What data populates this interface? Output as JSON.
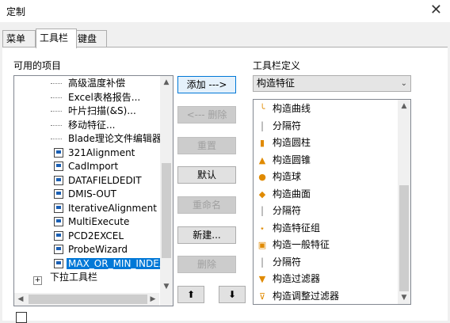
{
  "window": {
    "title": "定制"
  },
  "tabs": [
    {
      "label": "菜单"
    },
    {
      "label": "工具栏"
    },
    {
      "label": "键盘"
    }
  ],
  "left": {
    "label": "可用的项目",
    "items": [
      {
        "text": "高级温度补偿",
        "icon": "dash-line"
      },
      {
        "text": "Excel表格报告...",
        "icon": "dash-line"
      },
      {
        "text": "叶片扫描(&S)...",
        "icon": "dash-line"
      },
      {
        "text": "移动特征...",
        "icon": "dash-line"
      },
      {
        "text": "Blade理论文件编辑器(&",
        "icon": "dash-line"
      },
      {
        "text": "321Alignment",
        "icon": "macro-icon"
      },
      {
        "text": "CadImport",
        "icon": "macro-icon"
      },
      {
        "text": "DATAFIELDEDIT",
        "icon": "macro-icon"
      },
      {
        "text": "DMIS-OUT",
        "icon": "macro-icon"
      },
      {
        "text": "IterativeAlignment",
        "icon": "macro-icon"
      },
      {
        "text": "MultiExecute",
        "icon": "macro-icon"
      },
      {
        "text": "PCD2EXCEL",
        "icon": "macro-icon"
      },
      {
        "text": "ProbeWizard",
        "icon": "macro-icon"
      },
      {
        "text": "MAX_OR_MIN_INDEX",
        "icon": "macro-icon",
        "selected": true
      },
      {
        "text": "下拉工具栏",
        "icon": "expand-icon"
      }
    ]
  },
  "buttons": {
    "add": "添加 --->",
    "remove": "<--- 删除",
    "reset": "重置",
    "default": "默认",
    "rename": "重命名",
    "new": "新建...",
    "delete": "删除",
    "up": "⬆",
    "down": "⬇"
  },
  "right": {
    "label": "工具栏定义",
    "combo_value": "构造特征",
    "items": [
      {
        "text": "构造曲线",
        "icon": "curve-icon"
      },
      {
        "text": "分隔符",
        "icon": "separator-icon"
      },
      {
        "text": "构造圆柱",
        "icon": "cylinder-icon"
      },
      {
        "text": "构造圆锥",
        "icon": "cone-icon"
      },
      {
        "text": "构造球",
        "icon": "sphere-icon"
      },
      {
        "text": "构造曲面",
        "icon": "surface-icon"
      },
      {
        "text": "分隔符",
        "icon": "separator-icon"
      },
      {
        "text": "构造特征组",
        "icon": "feature-set-icon"
      },
      {
        "text": "构造一般特征",
        "icon": "generic-feature-icon"
      },
      {
        "text": "分隔符",
        "icon": "separator-icon"
      },
      {
        "text": "构造过滤器",
        "icon": "filter-icon"
      },
      {
        "text": "构造调整过滤器",
        "icon": "adjust-filter-icon"
      }
    ]
  },
  "colors": {
    "selection": "#0078d7",
    "accent": "#e08a00"
  }
}
